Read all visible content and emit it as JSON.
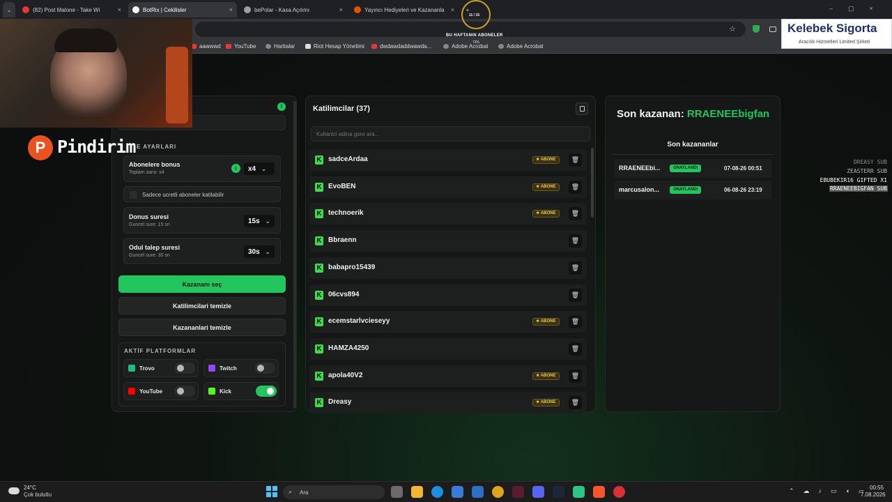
{
  "browser": {
    "tabs": [
      {
        "title": "(82) Post Malone - Take Wi",
        "color": "#e53935"
      },
      {
        "title": "BotRix | Cekilisler",
        "color": "#ffffff"
      },
      {
        "title": "bePolar - Kasa Açılımı",
        "color": "#9e9e9e"
      },
      {
        "title": "Yayıncı Hediyeleri ve Kazananla",
        "color": "#e65100"
      }
    ],
    "bookmarks": [
      "aawwwd",
      "YouTube",
      "Haritalar",
      "Riot Hesap Yönetimi",
      "dwdawdaddwawda...",
      "Adobe Acrobat",
      "Adobe Acrobat"
    ]
  },
  "overlay": {
    "stream_logo": "Pindirim",
    "goal_counter": "11 / 15",
    "goal_title": "BU HAFTANIN ABONELER",
    "goal_percent": "73%",
    "sponsor_name": "Kelebek Sigorta",
    "sponsor_sub": "Aracılık Hizmetleri Limited Şirketi",
    "sub_feed": [
      "DREASY SUB",
      "ZEASTERR SUB",
      "EBUBEKIR16 GIFTED X1",
      "RRAENEEBIGFAN SUB"
    ]
  },
  "settings": {
    "section_title": "E AYARLARI",
    "subscriber_bonus": {
      "label": "Abonelere bonus",
      "sub": "Toplam sans: x4",
      "value": "x4"
    },
    "paid_only_label": "Sadece ucretli aboneler katilabilir",
    "donus": {
      "label": "Donus suresi",
      "sub": "Guncel sure: 15 sn",
      "value": "15s"
    },
    "odul": {
      "label": "Odul talep suresi",
      "sub": "Guncel sure: 30 sn",
      "value": "30s"
    },
    "pick_winner": "Kazananı seç",
    "clear_participants": "Katilimcilari temizle",
    "clear_winners": "Kazananlari temizle",
    "platforms_title": "AKTİF PLATFORMLAR",
    "platforms": [
      {
        "name": "Trovo",
        "color": "#1ebe7a",
        "on": false
      },
      {
        "name": "Twitch",
        "color": "#9146ff",
        "on": false
      },
      {
        "name": "YouTube",
        "color": "#ff0000",
        "on": false
      },
      {
        "name": "Kick",
        "color": "#53fc18",
        "on": true
      }
    ]
  },
  "participants": {
    "title": "Katilimcilar (37)",
    "search_placeholder": "Kullanici adina gore ara...",
    "badge_label": "ABONE",
    "list": [
      {
        "name": "sadceArdaa",
        "sub": true
      },
      {
        "name": "EvoBEN",
        "sub": true
      },
      {
        "name": "technoerik",
        "sub": true
      },
      {
        "name": "Bbraenn",
        "sub": false
      },
      {
        "name": "babapro15439",
        "sub": false
      },
      {
        "name": "06cvs894",
        "sub": false
      },
      {
        "name": "ecemstarlvcieseyy",
        "sub": true
      },
      {
        "name": "HAMZA4250",
        "sub": false
      },
      {
        "name": "apola40V2",
        "sub": true
      },
      {
        "name": "Dreasy",
        "sub": true
      }
    ]
  },
  "winners": {
    "last_label": "Son kazanan:",
    "last_name": "RRAENEEbigfan",
    "list_title": "Son kazananlar",
    "status_label": "ONAYLANDI",
    "list": [
      {
        "name": "RRAENEEbi...",
        "time": "07-08-26 00:51"
      },
      {
        "name": "marcusalon...",
        "time": "06-08-26 23:19"
      }
    ]
  },
  "taskbar": {
    "temp": "24°C",
    "weather": "Çok bulutlu",
    "search": "Ara",
    "time": "00:55",
    "date": "7.08.2026"
  }
}
